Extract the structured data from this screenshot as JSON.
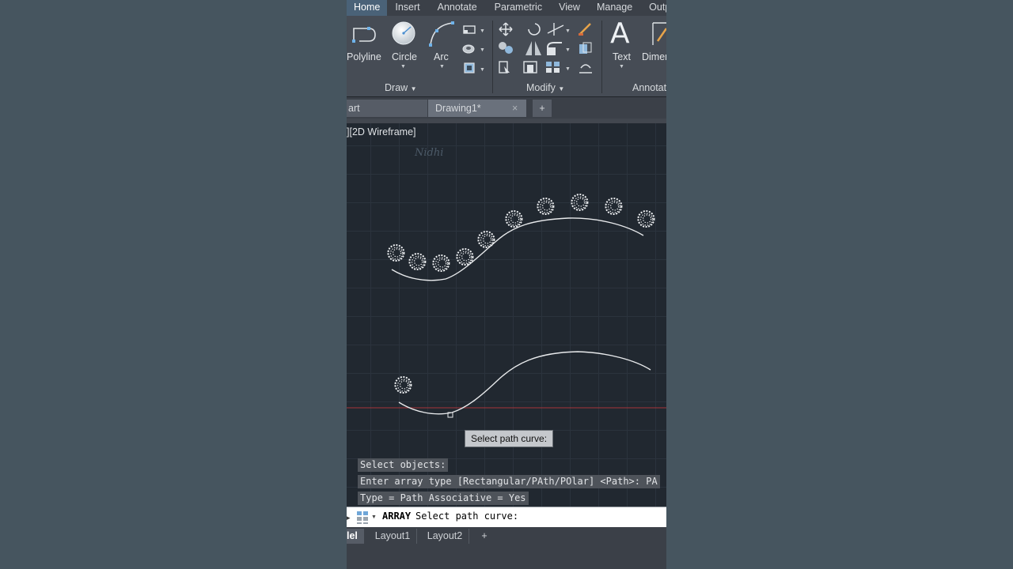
{
  "ribbon": {
    "tabs": [
      "Home",
      "Insert",
      "Annotate",
      "Parametric",
      "View",
      "Manage",
      "Outp"
    ],
    "tools": {
      "polyline": "Polyline",
      "circle": "Circle",
      "arc": "Arc",
      "text": "Text",
      "dimension": "Dimer"
    },
    "panels": {
      "draw": "Draw",
      "modify": "Modify",
      "annotation": "Annotat"
    }
  },
  "file_tabs": {
    "start": "art",
    "drawing": "Drawing1*",
    "close_glyph": "×",
    "add_glyph": "+"
  },
  "viewport": {
    "label": "][2D Wireframe]",
    "watermark": "Nidhi"
  },
  "tooltip": "Select path curve:",
  "command_history": [
    "Select objects:",
    "Enter array type [Rectangular/PAth/POlar] <Path>: PA",
    "Type = Path  Associative = Yes"
  ],
  "command_line": {
    "command": "ARRAY",
    "prompt": "Select path curve:"
  },
  "layout_tabs": {
    "model": "lel",
    "layout1": "Layout1",
    "layout2": "Layout2",
    "add_glyph": "+"
  },
  "colors": {
    "active_tab": "#4a6278",
    "canvas": "#212830",
    "curve": "#e8eaec",
    "x_axis": "#a8343a"
  }
}
